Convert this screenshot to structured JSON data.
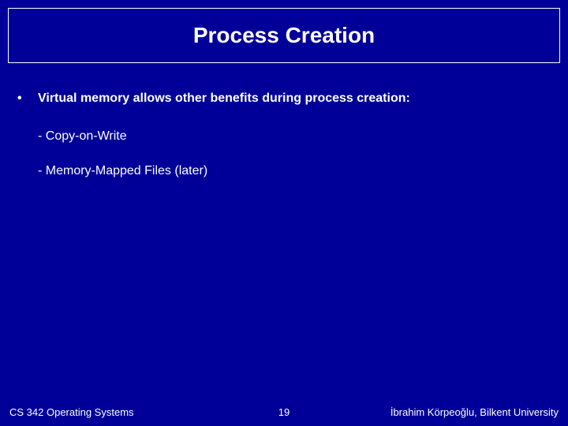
{
  "title": "Process Creation",
  "bullets": [
    {
      "text": "Virtual memory allows other benefits during process creation:",
      "subs": [
        "- Copy-on-Write",
        "- Memory-Mapped Files (later)"
      ]
    }
  ],
  "footer": {
    "left": "CS 342 Operating Systems",
    "center": "19",
    "right": "İbrahim Körpeoğlu, Bilkent University"
  }
}
